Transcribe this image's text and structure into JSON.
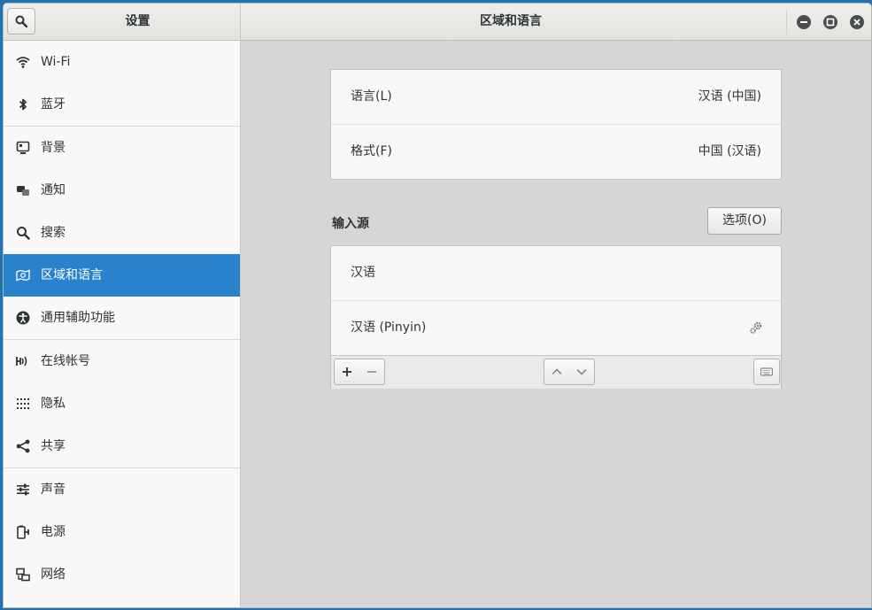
{
  "header": {
    "sidebar_title": "设置",
    "title": "区域和语言"
  },
  "sidebar": {
    "items": [
      {
        "label": "Wi-Fi",
        "icon": "wifi-icon"
      },
      {
        "label": "蓝牙",
        "icon": "bluetooth-icon"
      },
      {
        "label": "背景",
        "icon": "background-icon"
      },
      {
        "label": "通知",
        "icon": "notifications-icon"
      },
      {
        "label": "搜索",
        "icon": "search-icon"
      },
      {
        "label": "区域和语言",
        "icon": "region-icon",
        "active": true
      },
      {
        "label": "通用辅助功能",
        "icon": "accessibility-icon"
      },
      {
        "label": "在线帐号",
        "icon": "online-accounts-icon"
      },
      {
        "label": "隐私",
        "icon": "privacy-icon"
      },
      {
        "label": "共享",
        "icon": "share-icon"
      },
      {
        "label": "声音",
        "icon": "sound-icon"
      },
      {
        "label": "电源",
        "icon": "power-icon"
      },
      {
        "label": "网络",
        "icon": "network-icon"
      }
    ]
  },
  "language": {
    "label": "语言(L)",
    "value": "汉语 (中国)"
  },
  "formats": {
    "label": "格式(F)",
    "value": "中国 (汉语)"
  },
  "input_sources": {
    "title": "输入源",
    "options_label": "选项(O)",
    "items": [
      {
        "label": "汉语"
      },
      {
        "label": "汉语 (Pinyin)",
        "has_settings": true
      }
    ]
  },
  "colors": {
    "accent": "#2a82cd",
    "desktop": "#1f73b5"
  }
}
